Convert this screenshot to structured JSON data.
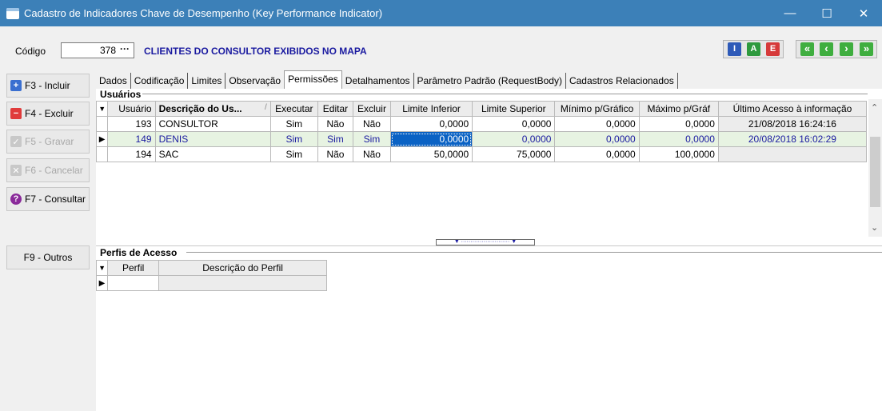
{
  "window": {
    "title": "Cadastro de Indicadores Chave de Desempenho (Key Performance Indicator)",
    "minimize": "—",
    "maximize": "☐",
    "close": "✕",
    "titlebar_color": "#3c80b8"
  },
  "code": {
    "label": "Código",
    "value": "378",
    "lookup": "···",
    "description": "CLIENTES DO CONSULTOR EXIBIDOS NO MAPA"
  },
  "toolbar": {
    "right_buttons": [
      {
        "label": "I",
        "color": "#2e5ab8"
      },
      {
        "label": "A",
        "color": "#2e9a3e"
      },
      {
        "label": "E",
        "color": "#d63a3a"
      }
    ],
    "nav_buttons": [
      {
        "glyph": "«",
        "icon": "first-icon"
      },
      {
        "glyph": "‹",
        "icon": "prev-icon"
      },
      {
        "glyph": "›",
        "icon": "next-icon"
      },
      {
        "glyph": "»",
        "icon": "last-icon"
      }
    ]
  },
  "sidebar": {
    "include": "F3 - Incluir",
    "delete": "F4 - Excluir",
    "save": "F5 - Gravar",
    "cancel": "F6 - Cancelar",
    "query": "F7 - Consultar",
    "others": "F9 - Outros"
  },
  "tabs": [
    "Dados",
    "Codificação",
    "Limites",
    "Observação",
    "Permissões",
    "Detalhamentos",
    "Parâmetro Padrão (RequestBody)",
    "Cadastros Relacionados"
  ],
  "active_tab": "Permissões",
  "users": {
    "title": "Usuários",
    "columns": [
      "Usuário",
      "Descrição do Us...",
      "Executar",
      "Editar",
      "Excluir",
      "Limite Inferior",
      "Limite Superior",
      "Mínimo p/Gráfico",
      "Máximo p/Gráf",
      "Último Acesso à informação"
    ],
    "sort_glyph": "/",
    "rows": [
      {
        "id": "193",
        "name": "CONSULTOR",
        "exec": "Sim",
        "edit": "Não",
        "del": "Não",
        "low": "0,0000",
        "high": "0,0000",
        "min": "0,0000",
        "max": "0,0000",
        "last": "21/08/2018 16:24:16"
      },
      {
        "id": "149",
        "name": "DENIS",
        "exec": "Sim",
        "edit": "Sim",
        "del": "Sim",
        "low": "0,0000",
        "high": "0,0000",
        "min": "0,0000",
        "max": "0,0000",
        "last": "20/08/2018 16:02:29"
      },
      {
        "id": "194",
        "name": "SAC",
        "exec": "Sim",
        "edit": "Não",
        "del": "Não",
        "low": "50,0000",
        "high": "75,0000",
        "min": "0,0000",
        "max": "100,0000",
        "last": ""
      }
    ]
  },
  "profiles": {
    "title": "Perfis de Acesso",
    "columns": [
      "Perfil",
      "Descrição do Perfil"
    ]
  },
  "colors": {
    "selected_row_bg": "#e7f3e2",
    "selected_row_text": "#1a1aa0",
    "focus_cell": "#0a62c4"
  }
}
